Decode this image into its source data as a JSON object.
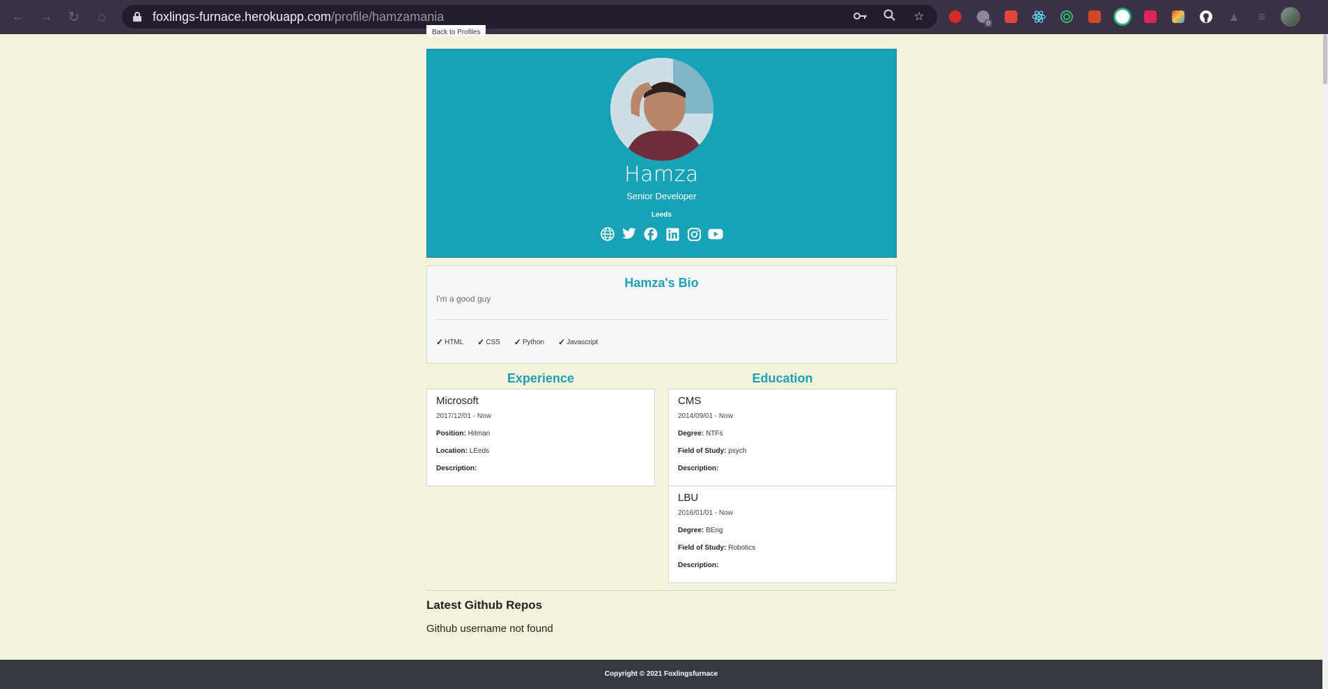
{
  "browser": {
    "url_host": "foxlings-furnace.herokuapp.com",
    "url_path": "/profile/hamzamania",
    "extension_badge": "0"
  },
  "page": {
    "back_link": "Back to Profiles"
  },
  "profile": {
    "name": "Hamza",
    "status": "Senior Developer",
    "location": "Leeds",
    "social_links": [
      "website-icon",
      "twitter-icon",
      "facebook-icon",
      "linkedin-icon",
      "instagram-icon",
      "youtube-icon"
    ]
  },
  "bio": {
    "title": "Hamza's Bio",
    "text": "I'm a good guy",
    "skills": [
      "HTML",
      "CSS",
      "Python",
      "Javascript"
    ]
  },
  "experience": {
    "title": "Experience",
    "items": [
      {
        "company": "Microsoft",
        "dates": "2017/12/01 - Now",
        "position_label": "Position:",
        "position": "Hitman",
        "location_label": "Location:",
        "location": "LEeds",
        "description_label": "Description:"
      }
    ]
  },
  "education": {
    "title": "Education",
    "items": [
      {
        "school": "CMS",
        "dates": "2014/09/01 - Now",
        "degree_label": "Degree:",
        "degree": "NTFs",
        "field_label": "Field of Study:",
        "field": "psych",
        "description_label": "Description:"
      },
      {
        "school": "LBU",
        "dates": "2016/01/01 - Now",
        "degree_label": "Degree:",
        "degree": "BEng",
        "field_label": "Field of Study:",
        "field": "Robotics",
        "description_label": "Description:"
      }
    ]
  },
  "github": {
    "title": "Latest Github Repos",
    "message": "Github username not found"
  },
  "footer": {
    "text": "Copyright © 2021 Foxlingsfurnace"
  },
  "colors": {
    "chrome_bg": "#3a3145",
    "omnibox_bg": "#241d2c",
    "page_bg": "#f4f4dc",
    "accent": "#17a2b8",
    "footer_bg": "#343a40"
  }
}
